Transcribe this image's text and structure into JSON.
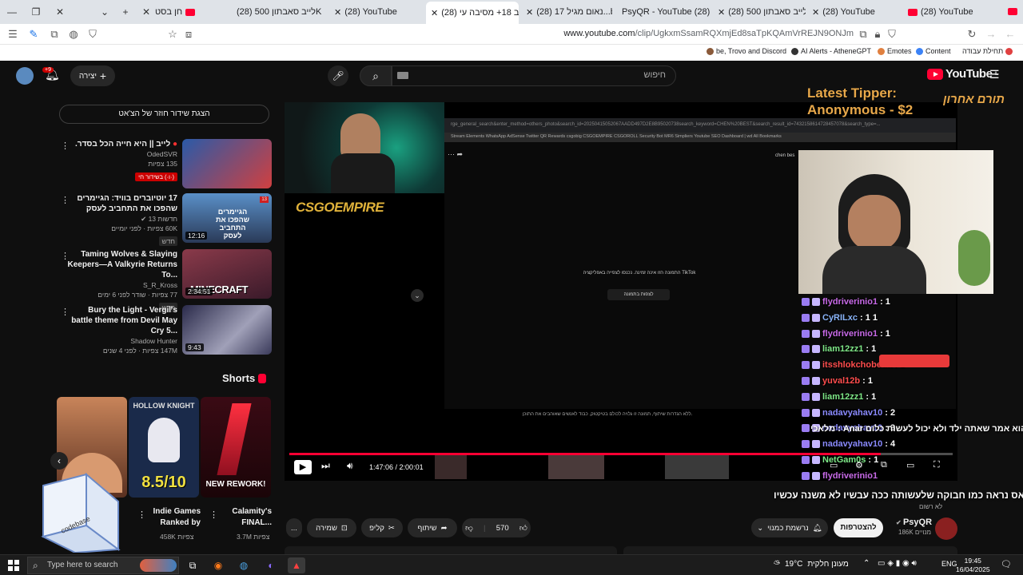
{
  "browser": {
    "tabs": [
      {
        "label": "חן בסט",
        "active": false
      },
      {
        "label": "(28) לייב סאבתון 500K",
        "active": false
      },
      {
        "label": "(28) YouTube",
        "active": false
      },
      {
        "label": "(28) לייב 18+ מסיבה עי",
        "active": true
      },
      {
        "label": "(28) נאום מגיל 17...be",
        "active": false
      },
      {
        "label": "PsyQR - YouTube (28)",
        "active": false
      },
      {
        "label": "(28) לייב סאבתון 500K",
        "active": false
      },
      {
        "label": "(28) YouTube",
        "active": false
      },
      {
        "label": "(28) YouTube",
        "active": false
      }
    ],
    "url_host": "www.youtube.com",
    "url_path": "/clip/UgkxmSsamRQXmjEd8saTpKQAmVrREJN9ONJm",
    "bookmarks": [
      {
        "label": "be, Trovo and Discord",
        "color": "#8a5a3a"
      },
      {
        "label": "AI Alerts - AtheneGPT",
        "color": "#333333"
      },
      {
        "label": "Emotes",
        "color": "#e08040"
      },
      {
        "label": "Content",
        "color": "#3b82f6"
      },
      {
        "label": "תחילת עבודה",
        "color": "#e04040"
      }
    ]
  },
  "masthead": {
    "search_placeholder": "חיפוש",
    "create_label": "יצירה",
    "notif_count": "+9",
    "logo_text": "YouTube",
    "logo_region": "IL"
  },
  "sidebar": {
    "live_chat_button": "הצגת שידור חוזר של הצ'אט",
    "related": [
      {
        "title": "לייב || היא חייה הכל בסדר.",
        "channel": "OdedSVR",
        "stats": "135 צפיות",
        "badge": "(·ו·) בשידור חי",
        "duration": "",
        "thumb_color": "#2a5aa8"
      },
      {
        "title": "17 יוטיוברים בוויד: הגיימרים שהפכו את התחביב לעסק",
        "channel": "חדשות 13",
        "stats": "60K צפיות · לפני יומיים",
        "badge": "חדש",
        "duration": "12:16",
        "thumb_color": "#3a6ea0"
      },
      {
        "title": "Taming Wolves & Slaying Keepers—A Valkyrie Returns To...",
        "channel": "S_R_Kross",
        "stats": "77 צפיות · שודר לפני 6 ימים",
        "badge": "חדש",
        "duration": "2:34:51",
        "thumb_color": "#6a2a3a"
      },
      {
        "title": "Bury the Light - Vergil's battle theme from Devil May Cry 5...",
        "channel": "Shadow Hunter",
        "stats": "147M צפיות · לפני 4 שנים",
        "badge": "",
        "duration": "9:43",
        "thumb_color": "#3a3a5a"
      }
    ],
    "thumb_captions": [
      "",
      "הגיימרים שהפכו את התחביב לעסק",
      "MINECRAFT",
      ""
    ],
    "shorts_heading": "Shorts",
    "shorts": [
      {
        "title": "תכנית ביתית...",
        "views": "",
        "color": "#c8845a"
      },
      {
        "title": "Indie Games Ranked by",
        "views": "458K צפיות",
        "color": "#1a3a6a"
      },
      {
        "title": "Calamity's FINAL...",
        "views": "3.7M צפיות",
        "color": "#2a0a10"
      }
    ],
    "short_overlay_texts": [
      "",
      "8.5/10",
      "NEW REWORK!"
    ],
    "short_top_texts": [
      "",
      "HOLLOW KNIGHT",
      ""
    ],
    "short_side_text": "סה מש"
  },
  "player": {
    "tipper_line1": "Latest Tipper:",
    "tipper_line2": "Anonymous - $2",
    "tipper_hebrew": "תורם אחרון",
    "csgo_logo_a": "CSGO",
    "csgo_logo_b": "EMPIRE",
    "inner_url": "rge_general_search&enter_method=others_photo&search_id=20250415052067AADD497D2E8B95020738search_keyword=CHEN%20BEST&search_result_id=7432158614728457078&search_type=...",
    "inner_bookmarks": "Stream Elements   WhatsApp   AdSense   Twitter   QR Rewards   csgobig   CSGOEMPIRE   CSGOROLL   Security Bot   MR6   Simpliers   Youtube SEO   Dashboard | wd   All Bookmarks",
    "inner_channel": "chen bes",
    "tiktok_message": "התמונה הזו אינה זמינה. נכנסו לצפייה באפליקציה TikTok",
    "tiktok_button": "לצפות בתמונה",
    "inner_footer": "ללא הגדרות שיתוף, תמונה זו גלויה לכולם בטיקטוק, כבוד לאנשים שאוהבים את התוכן.",
    "chat": [
      {
        "user": "flydriverinio1",
        "msg": ": 1",
        "color": "#c86ae8"
      },
      {
        "user": "CyRILxc",
        "msg": ": 1 1",
        "color": "#8ab4f8"
      },
      {
        "user": "flydriverinio1",
        "msg": ": 1",
        "color": "#c86ae8"
      },
      {
        "user": "liam12zz1",
        "msg": ": 1",
        "color": "#7ee787"
      },
      {
        "user": "itsshlokchobeda",
        "msg": ": 1",
        "color": "#ff4d4d"
      },
      {
        "user": "yuval12b",
        "msg": ": 1",
        "color": "#ff4d4d"
      },
      {
        "user": "liam12zz1",
        "msg": ": 1",
        "color": "#7ee787"
      },
      {
        "user": "nadavyahav10",
        "msg": ": 2",
        "color": "#8a8aff"
      },
      {
        "user": "nadavyahav10",
        "msg": ": 3",
        "color": "#8a8aff"
      },
      {
        "user": "nadavyahav10",
        "msg": ": 4",
        "color": "#8a8aff"
      },
      {
        "user": "NetGam0s",
        "msg": ": 1",
        "color": "#7ee787"
      },
      {
        "user": "flydriverinio1",
        "msg": "",
        "color": "#c86ae8"
      }
    ],
    "chat_overlay_1": "הוא אמר שאתה ילד ולא יכול לעשות כלום Anar : מלאכי",
    "chat_overlay_2": "! פאס נראה כמו חבוקה שלעשותה ככה עבשיו לא משנה עכשיו",
    "elapsed": "1:47:06",
    "duration": "2:00:01",
    "progress": 0.892
  },
  "channel": {
    "name": "PsyQR",
    "subscribers": "186K מנויים",
    "subscribe_label": "להצטרפות",
    "subscribed_label": "נרשמת כמנוי",
    "join_note": "לא רשום"
  },
  "actions": {
    "likes": "570",
    "share": "שיתוף",
    "clip": "קליפ",
    "save": "שמירה",
    "more": "..."
  },
  "taskbar": {
    "search_placeholder": "Type here to search",
    "weather_temp": "19°C",
    "weather_desc": "מעונן חלקית",
    "language": "ENG",
    "time": "19:45",
    "date": "16/04/2025"
  },
  "codebase_label": "codebase"
}
